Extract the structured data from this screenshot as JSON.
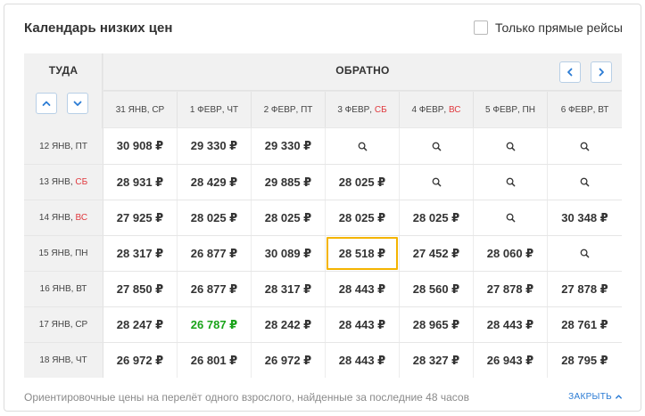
{
  "title": "Календарь низких цен",
  "direct_only": {
    "label": "Только прямые рейсы",
    "checked": false
  },
  "outbound_header": "ТУДА",
  "return_header": "ОБРАТНО",
  "return_dates": [
    {
      "date": "31 ЯНВ",
      "day": "СР",
      "weekend": false
    },
    {
      "date": "1 ФЕВР",
      "day": "ЧТ",
      "weekend": false
    },
    {
      "date": "2 ФЕВР",
      "day": "ПТ",
      "weekend": false
    },
    {
      "date": "3 ФЕВР",
      "day": "СБ",
      "weekend": true
    },
    {
      "date": "4 ФЕВР",
      "day": "ВС",
      "weekend": true
    },
    {
      "date": "5 ФЕВР",
      "day": "ПН",
      "weekend": false
    },
    {
      "date": "6 ФЕВР",
      "day": "ВТ",
      "weekend": false
    }
  ],
  "rows": [
    {
      "date": "12 ЯНВ",
      "day": "ПТ",
      "weekend": false,
      "prices": [
        "30 908 ₽",
        "29 330 ₽",
        "29 330 ₽",
        null,
        null,
        null,
        null
      ]
    },
    {
      "date": "13 ЯНВ",
      "day": "СБ",
      "weekend": true,
      "prices": [
        "28 931 ₽",
        "28 429 ₽",
        "29 885 ₽",
        "28 025 ₽",
        null,
        null,
        null
      ]
    },
    {
      "date": "14 ЯНВ",
      "day": "ВС",
      "weekend": true,
      "prices": [
        "27 925 ₽",
        "28 025 ₽",
        "28 025 ₽",
        "28 025 ₽",
        "28 025 ₽",
        null,
        "30 348 ₽"
      ]
    },
    {
      "date": "15 ЯНВ",
      "day": "ПН",
      "weekend": false,
      "prices": [
        "28 317 ₽",
        "26 877 ₽",
        "30 089 ₽",
        "28 518 ₽",
        "27 452 ₽",
        "28 060 ₽",
        null
      ]
    },
    {
      "date": "16 ЯНВ",
      "day": "ВТ",
      "weekend": false,
      "prices": [
        "27 850 ₽",
        "26 877 ₽",
        "28 317 ₽",
        "28 443 ₽",
        "28 560 ₽",
        "27 878 ₽",
        "27 878 ₽"
      ]
    },
    {
      "date": "17 ЯНВ",
      "day": "СР",
      "weekend": false,
      "prices": [
        "28 247 ₽",
        "26 787 ₽",
        "28 242 ₽",
        "28 443 ₽",
        "28 965 ₽",
        "28 443 ₽",
        "28 761 ₽"
      ]
    },
    {
      "date": "18 ЯНВ",
      "day": "ЧТ",
      "weekend": false,
      "prices": [
        "26 972 ₽",
        "26 801 ₽",
        "26 972 ₽",
        "28 443 ₽",
        "28 327 ₽",
        "26 943 ₽",
        "28 795 ₽"
      ]
    }
  ],
  "selected": {
    "row": 3,
    "col": 3
  },
  "cheapest": {
    "row": 5,
    "col": 1
  },
  "colors": {
    "accent": "#2a7bd4",
    "weekend": "#e0393e",
    "cheapest": "#1aa31a",
    "selected_border": "#f4b400"
  },
  "footnote": "Ориентировочные цены на перелёт одного взрослого, найденные за последние 48 часов",
  "collapse_label": "ЗАКРЫТЬ"
}
